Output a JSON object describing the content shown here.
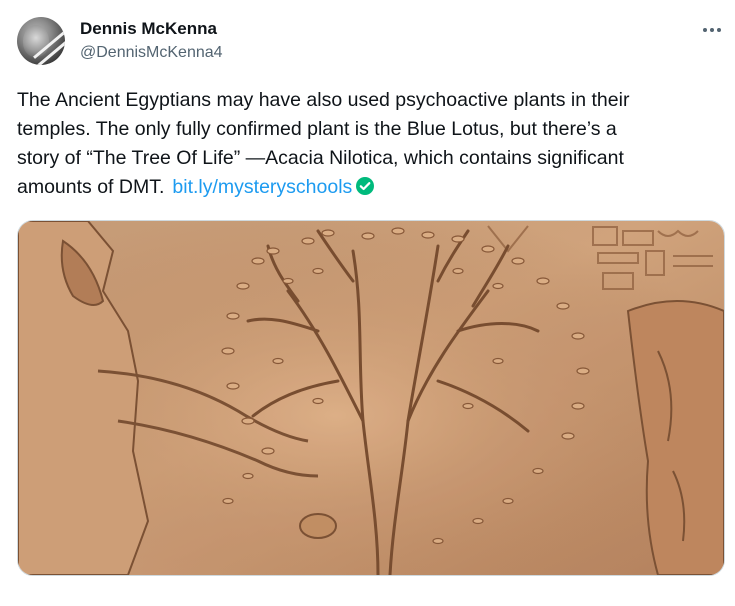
{
  "author": {
    "display_name": "Dennis McKenna",
    "handle": "@DennisMcKenna4",
    "avatar_icon": "profile-photo"
  },
  "menu": {
    "icon": "more-horizontal-icon"
  },
  "tweet": {
    "lines": [
      "The Ancient Egyptians may have also used psychoactive plants in their",
      "temples. The only fully confirmed plant is the Blue Lotus, but there’s a",
      "story of “The Tree Of Life” —Acacia Nilotica, which contains significant",
      "amounts of DMT."
    ],
    "link": "bit.ly/mysteryschools",
    "link_badge_icon": "verified-check-icon"
  },
  "media": {
    "icon": "egyptian-relief-tree-image",
    "colors": {
      "stone_light": "#d9ab84",
      "stone_mid": "#c08a62",
      "stone_dark": "#8f5f3e"
    }
  },
  "colors": {
    "text": "#0f1419",
    "secondary": "#536471",
    "link": "#1d9bf0",
    "verified": "#00ba7c"
  }
}
